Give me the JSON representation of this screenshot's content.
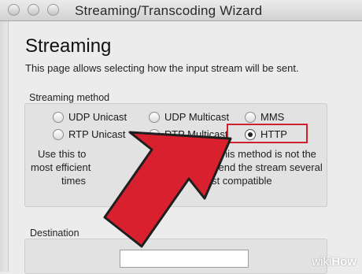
{
  "window": {
    "title": "Streaming/Transcoding Wizard"
  },
  "page": {
    "heading": "Streaming",
    "description": "This page allows selecting how the input stream will be sent."
  },
  "streaming_method": {
    "label": "Streaming method",
    "options": [
      {
        "label": "UDP Unicast",
        "selected": false
      },
      {
        "label": "UDP Multicast",
        "selected": false
      },
      {
        "label": "MMS",
        "selected": false
      },
      {
        "label": "RTP Unicast",
        "selected": false
      },
      {
        "label": "RTP Multicast",
        "selected": false
      },
      {
        "label": "HTTP",
        "selected": true
      }
    ],
    "help_text_left": [
      "Use this to",
      "most efficient",
      "times"
    ],
    "help_text_right": [
      "This method is not the",
      "send the stream several",
      "most compatible"
    ]
  },
  "destination": {
    "label": "Destination",
    "value": ""
  },
  "annotation": {
    "highlight_color": "#d0202e",
    "arrow_color": "#d9202f"
  },
  "watermark": {
    "prefix": "wiki",
    "suffix": "How"
  }
}
